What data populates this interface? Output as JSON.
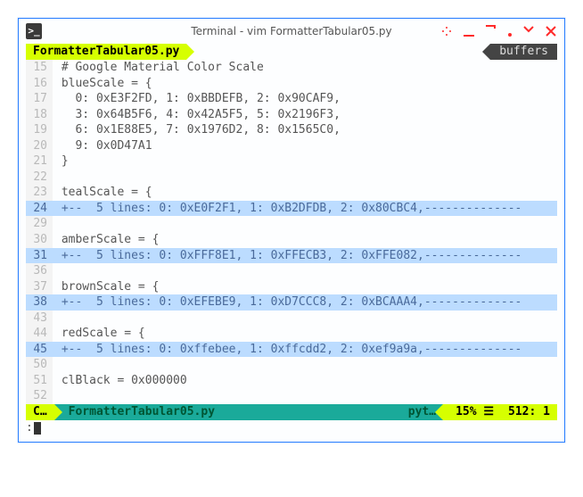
{
  "window": {
    "title": "Terminal - vim FormatterTabular05.py"
  },
  "bufferline": {
    "active_tab": "FormatterTabular05.py",
    "right_label": "buffers"
  },
  "lines": [
    {
      "n": "15",
      "text": " # Google Material Color Scale",
      "fold": false
    },
    {
      "n": "16",
      "text": " blueScale = {",
      "fold": false
    },
    {
      "n": "17",
      "text": "   0: 0xE3F2FD, 1: 0xBBDEFB, 2: 0x90CAF9,",
      "fold": false
    },
    {
      "n": "18",
      "text": "   3: 0x64B5F6, 4: 0x42A5F5, 5: 0x2196F3,",
      "fold": false
    },
    {
      "n": "19",
      "text": "   6: 0x1E88E5, 7: 0x1976D2, 8: 0x1565C0,",
      "fold": false
    },
    {
      "n": "20",
      "text": "   9: 0x0D47A1",
      "fold": false
    },
    {
      "n": "21",
      "text": " }",
      "fold": false
    },
    {
      "n": "22",
      "text": "",
      "fold": false
    },
    {
      "n": "23",
      "text": " tealScale = {",
      "fold": false
    },
    {
      "n": "24",
      "text": " +--  5 lines: 0: 0xE0F2F1, 1: 0xB2DFDB, 2: 0x80CBC4,--------------",
      "fold": true
    },
    {
      "n": "29",
      "text": "",
      "fold": false
    },
    {
      "n": "30",
      "text": " amberScale = {",
      "fold": false
    },
    {
      "n": "31",
      "text": " +--  5 lines: 0: 0xFFF8E1, 1: 0xFFECB3, 2: 0xFFE082,--------------",
      "fold": true
    },
    {
      "n": "36",
      "text": "",
      "fold": false
    },
    {
      "n": "37",
      "text": " brownScale = {",
      "fold": false
    },
    {
      "n": "38",
      "text": " +--  5 lines: 0: 0xEFEBE9, 1: 0xD7CCC8, 2: 0xBCAAA4,--------------",
      "fold": true
    },
    {
      "n": "43",
      "text": "",
      "fold": false
    },
    {
      "n": "44",
      "text": " redScale = {",
      "fold": false
    },
    {
      "n": "45",
      "text": " +--  5 lines: 0: 0xffebee, 1: 0xffcdd2, 2: 0xef9a9a,--------------",
      "fold": true
    },
    {
      "n": "50",
      "text": "",
      "fold": false
    },
    {
      "n": "51",
      "text": " clBlack = 0x000000",
      "fold": false
    },
    {
      "n": "52",
      "text": "",
      "fold": false
    }
  ],
  "statusline": {
    "mode": "C…",
    "file": "FormatterTabular05.py",
    "filetype": "pyt…",
    "percent": "15% ☰",
    "position": "512: 1"
  },
  "cmdline": {
    "prompt": ":"
  }
}
